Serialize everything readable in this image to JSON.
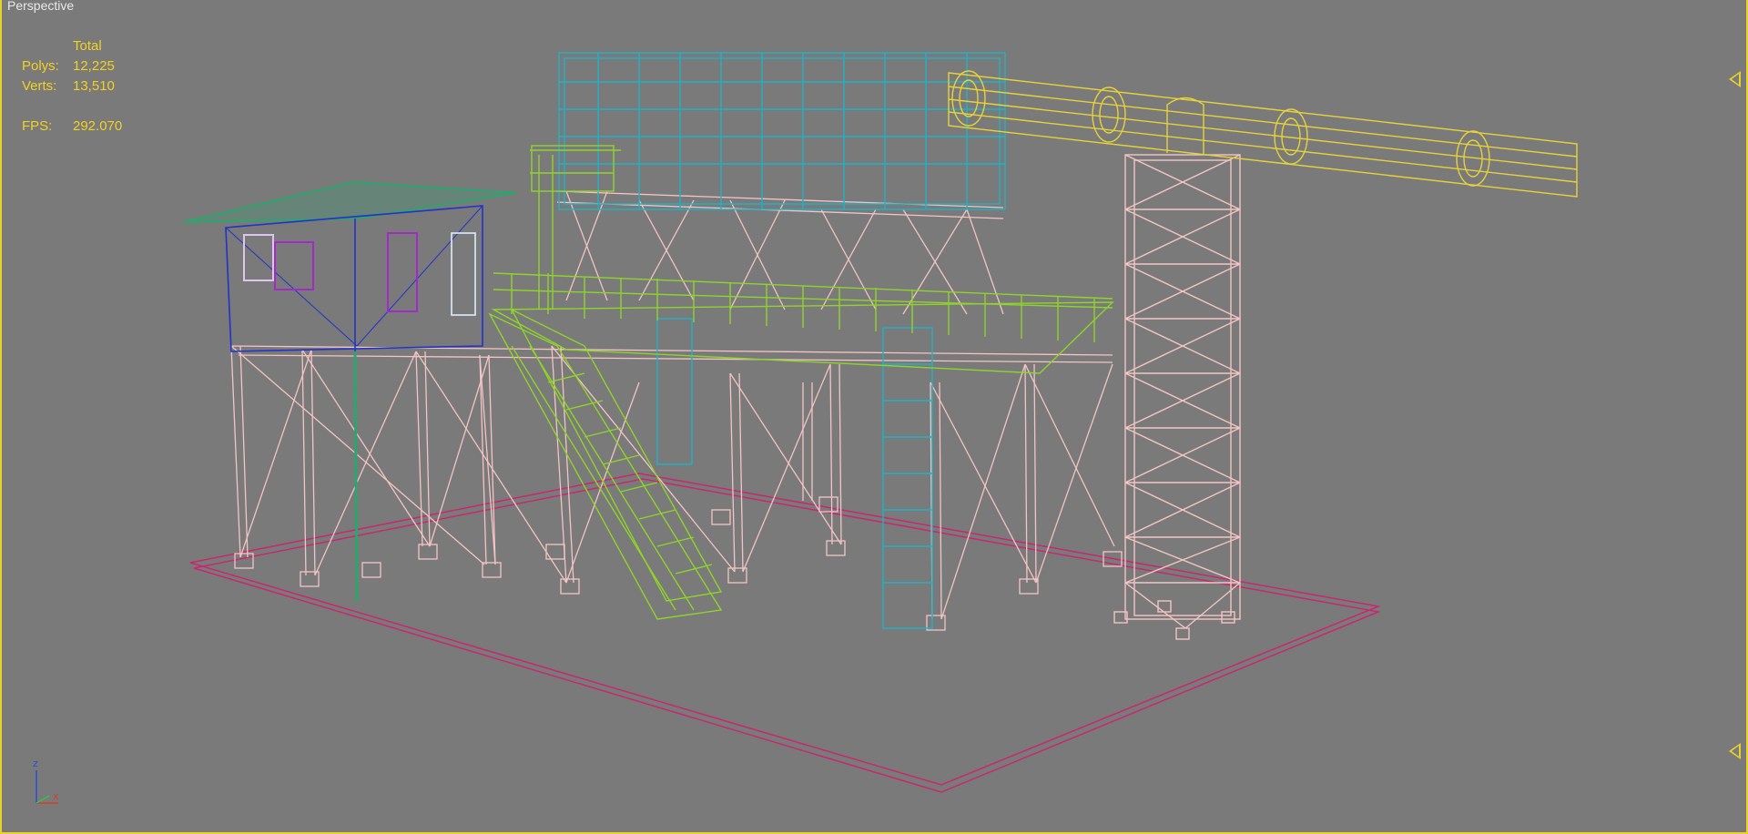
{
  "viewport": {
    "label": "Perspective"
  },
  "stats": {
    "header": "Total",
    "polys_label": "Polys:",
    "polys_value": "12,225",
    "verts_label": "Verts:",
    "verts_value": "13,510",
    "fps_label": "FPS:",
    "fps_value": "292.070"
  },
  "axis": {
    "z": "z",
    "x": "x"
  },
  "colors": {
    "background": "#7a7a7a",
    "border": "#e8d22a",
    "stats_text": "#f2d21f",
    "pink_frame": "#f4c4c4",
    "green_rail": "#8ed42a",
    "cyan_structure": "#1fb2c8",
    "yellow_pipe": "#e6d23a",
    "blue_cabin": "#2233c8",
    "roof_green": "#2ca56e",
    "ground_plane": "#c8286e"
  },
  "icons": {
    "axis_gizmo": "xyz-axis-icon",
    "viewport_marker": "triangle-marker-icon"
  }
}
